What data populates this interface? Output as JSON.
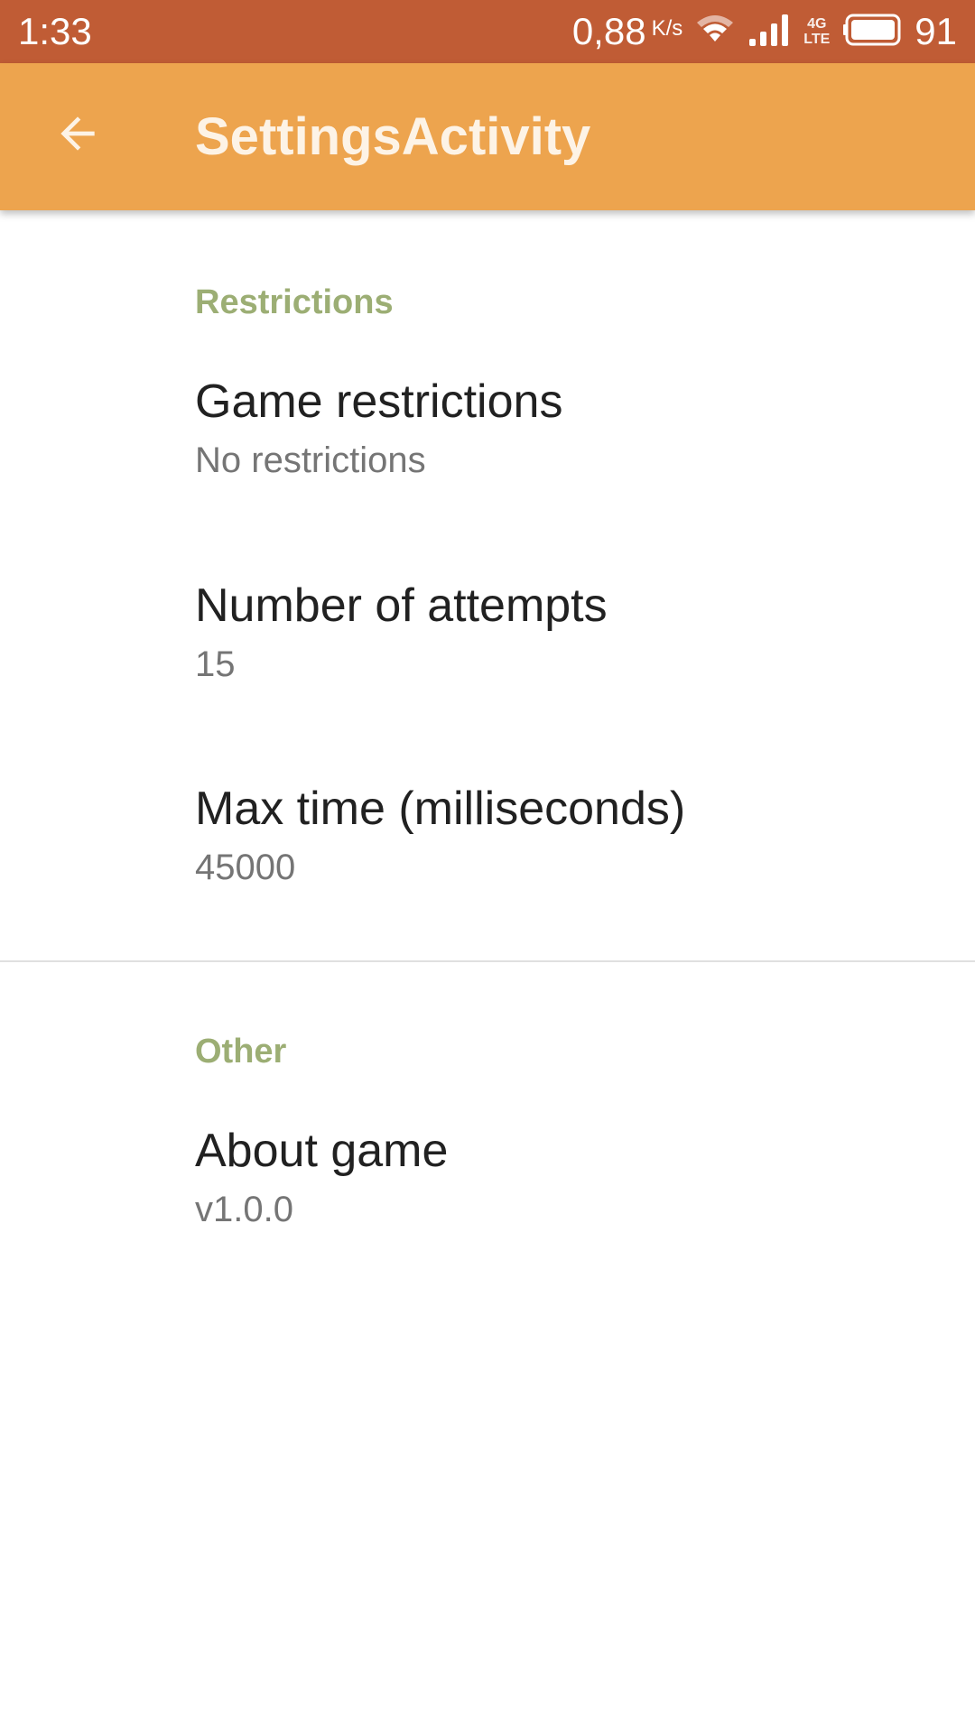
{
  "status_bar": {
    "time": "1:33",
    "net_speed": "0,88",
    "net_unit": "K/s",
    "lte_top": "4G",
    "lte_bottom": "LTE",
    "battery": "91",
    "icons": [
      "wifi-icon",
      "signal-icon",
      "battery-icon"
    ]
  },
  "app_bar": {
    "title": "SettingsActivity",
    "back_icon": "arrow-back-icon",
    "color": "#eda44e"
  },
  "sections": [
    {
      "header": "Restrictions",
      "items": [
        {
          "title": "Game restrictions",
          "summary": "No restrictions"
        },
        {
          "title": "Number of attempts",
          "summary": "15"
        },
        {
          "title": "Max time (milliseconds)",
          "summary": "45000"
        }
      ]
    },
    {
      "header": "Other",
      "items": [
        {
          "title": "About game",
          "summary": "v1.0.0"
        }
      ]
    }
  ],
  "colors": {
    "status_bar": "#c05c35",
    "category_header": "#9cae74",
    "title_text": "#212121",
    "summary_text": "#757575"
  }
}
